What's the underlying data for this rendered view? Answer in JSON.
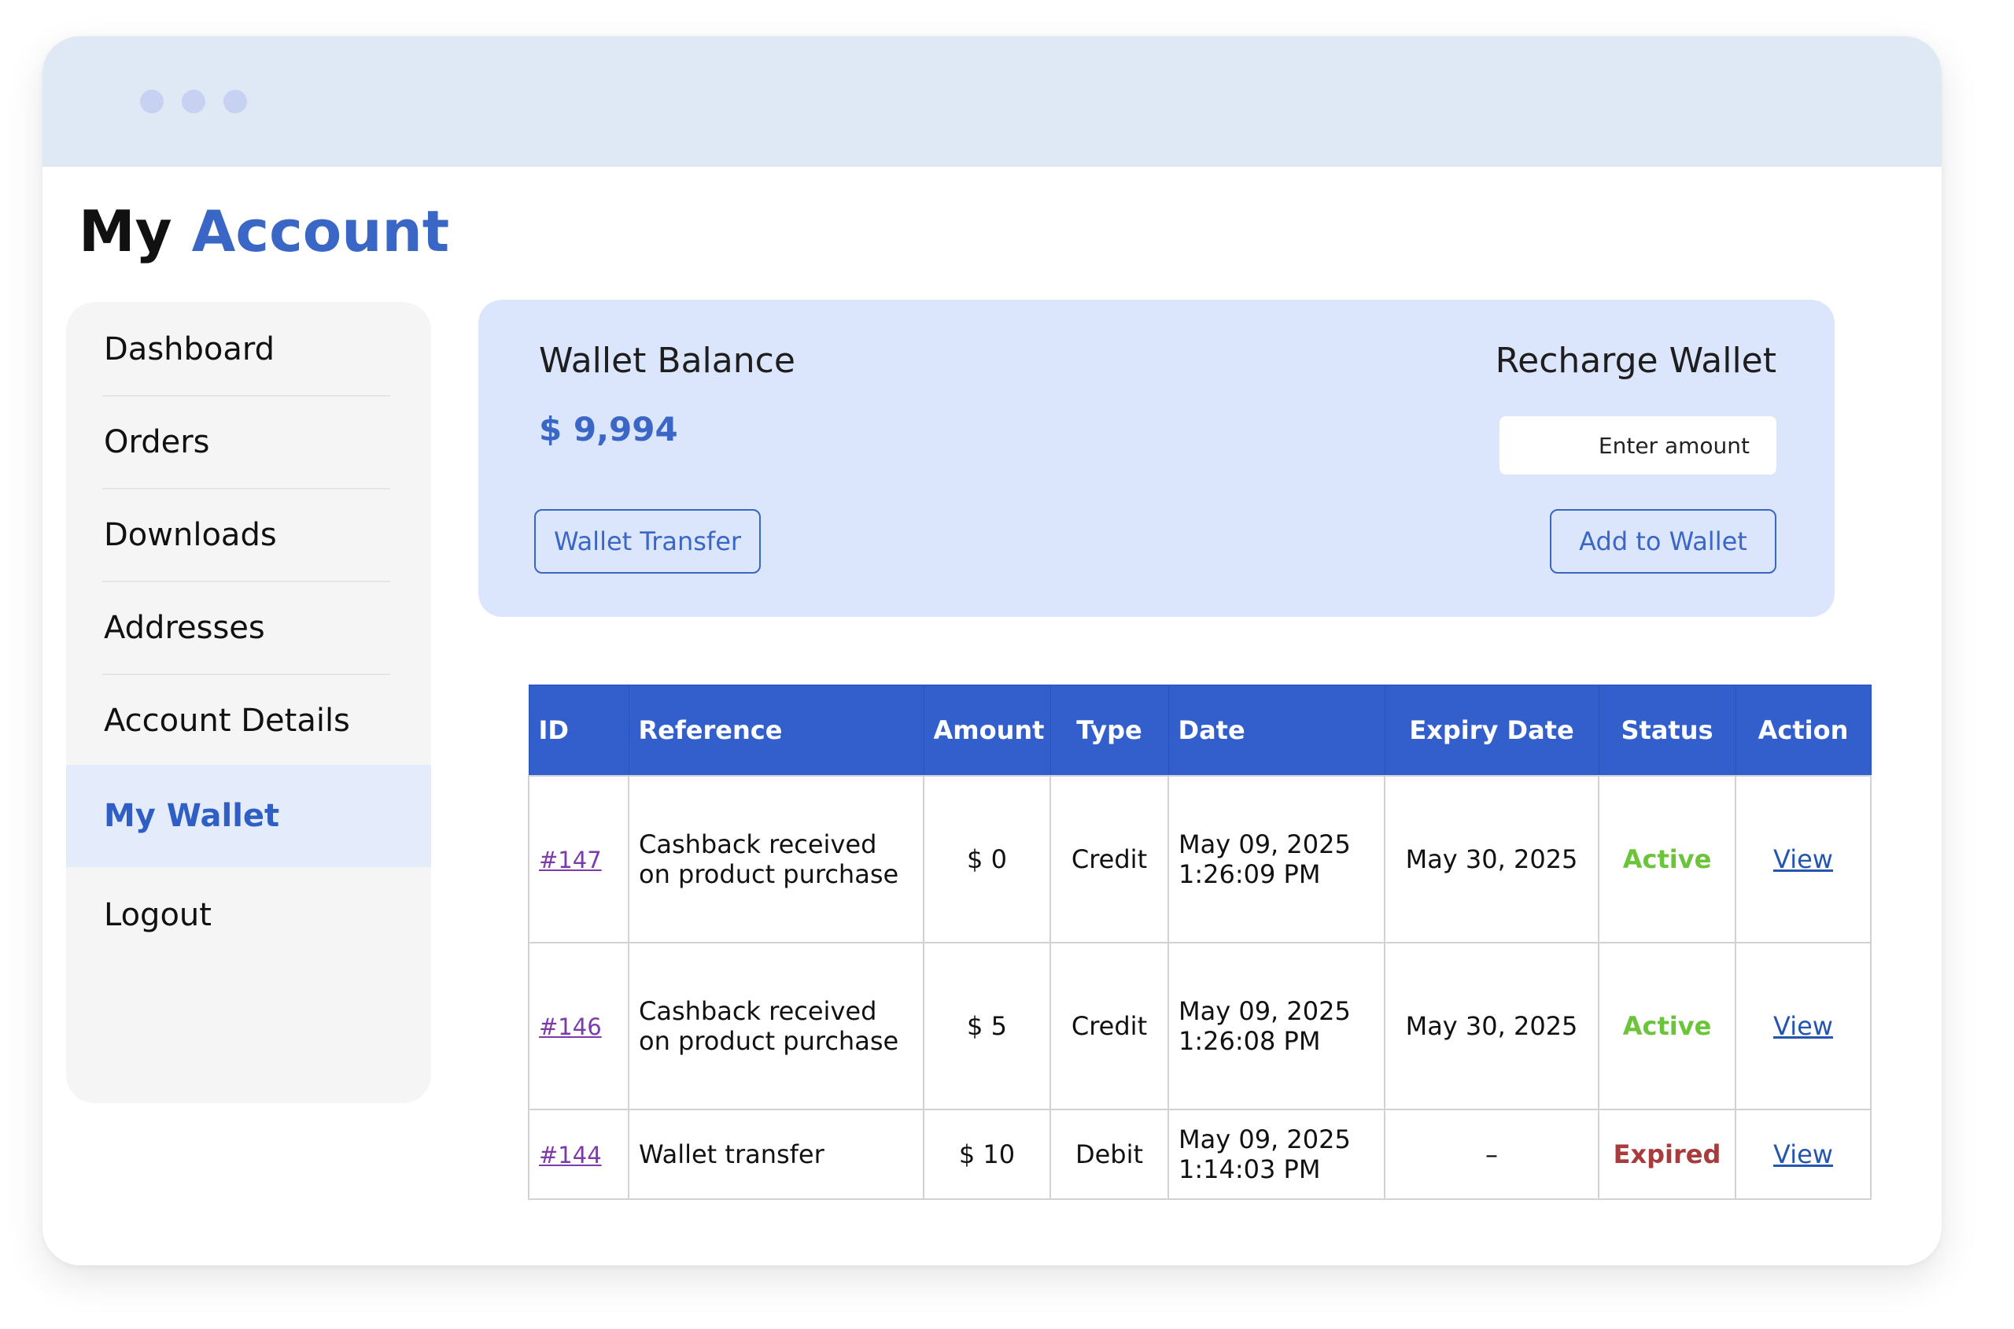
{
  "page": {
    "title_main": "My",
    "title_accent": "Account"
  },
  "sidebar": {
    "items": [
      {
        "label": "Dashboard"
      },
      {
        "label": "Orders"
      },
      {
        "label": "Downloads"
      },
      {
        "label": "Addresses"
      },
      {
        "label": "Account Details"
      },
      {
        "label": "My Wallet",
        "active": true
      },
      {
        "label": "Logout"
      }
    ]
  },
  "wallet": {
    "balance_label": "Wallet Balance",
    "balance_value": "$ 9,994",
    "recharge_label": "Recharge Wallet",
    "amount_placeholder": "Enter amount",
    "transfer_button": "Wallet Transfer",
    "add_button": "Add to Wallet"
  },
  "table": {
    "headers": [
      "ID",
      "Reference",
      "Amount",
      "Type",
      "Date",
      "Expiry Date",
      "Status",
      "Action"
    ],
    "rows": [
      {
        "id": "#147",
        "reference_line1": "Cashback received",
        "reference_line2": "on product purchase",
        "amount": "$ 0",
        "type": "Credit",
        "date_line1": "May 09, 2025",
        "date_line2": "1:26:09 PM",
        "expiry": "May 30, 2025",
        "status": "Active",
        "action": "View"
      },
      {
        "id": "#146",
        "reference_line1": "Cashback received",
        "reference_line2": "on product purchase",
        "amount": "$ 5",
        "type": "Credit",
        "date_line1": "May 09, 2025",
        "date_line2": "1:26:08 PM",
        "expiry": "May 30, 2025",
        "status": "Active",
        "action": "View"
      },
      {
        "id": "#144",
        "reference_line1": "Wallet transfer",
        "amount": "$ 10",
        "type": "Debit",
        "date_line1": "May 09, 2025",
        "date_line2": "1:14:03 PM",
        "expiry": "–",
        "status": "Expired",
        "action": "View"
      }
    ]
  },
  "colors": {
    "accent": "#3a66c5",
    "header_bg": "#335fcc",
    "titlebar_bg": "#dfe8f5",
    "card_bg": "#dbe5fb",
    "status_active": "#6cc43b",
    "status_expired": "#a83b3b"
  }
}
